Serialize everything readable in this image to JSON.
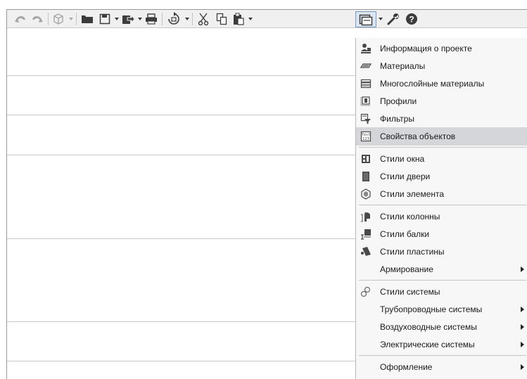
{
  "toolbar": {
    "buttons": [
      {
        "name": "undo-button",
        "icon": "undo-icon",
        "disabled": true
      },
      {
        "name": "redo-button",
        "icon": "redo-icon",
        "disabled": true
      },
      {
        "name": "3d-view-button",
        "icon": "cube-icon",
        "disabled": true
      },
      {
        "name": "open-button",
        "icon": "folder-icon"
      },
      {
        "name": "save-button",
        "icon": "floppy-icon"
      },
      {
        "name": "export-button",
        "icon": "export-icon"
      },
      {
        "name": "print-button",
        "icon": "printer-icon"
      },
      {
        "name": "update-button",
        "icon": "refresh-icon"
      },
      {
        "name": "cut-button",
        "icon": "scissors-icon"
      },
      {
        "name": "copy-button",
        "icon": "copy-icon"
      },
      {
        "name": "paste-button",
        "icon": "paste-icon"
      },
      {
        "name": "manage-styles-button",
        "icon": "styles-icon",
        "active": true
      },
      {
        "name": "settings-button",
        "icon": "wrench-icon"
      },
      {
        "name": "help-button",
        "icon": "help-icon"
      }
    ]
  },
  "menu": {
    "items": [
      {
        "label": "Информация о проекте",
        "icon": "project-info-icon"
      },
      {
        "label": "Материалы",
        "icon": "materials-icon"
      },
      {
        "label": "Многослойные материалы",
        "icon": "multilayer-icon"
      },
      {
        "label": "Профили",
        "icon": "profiles-icon"
      },
      {
        "label": "Фильтры",
        "icon": "filters-icon"
      },
      {
        "label": "Свойства объектов",
        "icon": "object-properties-icon",
        "highlighted": true
      },
      {
        "label": "Стили окна",
        "icon": "window-style-icon"
      },
      {
        "label": "Стили двери",
        "icon": "door-style-icon"
      },
      {
        "label": "Стили элемента",
        "icon": "element-style-icon"
      },
      {
        "label": "Стили колонны",
        "icon": "column-style-icon"
      },
      {
        "label": "Стили балки",
        "icon": "beam-style-icon"
      },
      {
        "label": "Стили пластины",
        "icon": "plate-style-icon"
      },
      {
        "label": "Армирование",
        "submenu": true
      },
      {
        "label": "Стили системы",
        "icon": "system-style-icon"
      },
      {
        "label": "Трубопроводные системы",
        "submenu": true
      },
      {
        "label": "Воздуховодные системы",
        "submenu": true
      },
      {
        "label": "Электрические системы",
        "submenu": true
      },
      {
        "label": "Оформление",
        "submenu": true
      }
    ]
  },
  "colors": {
    "highlight": "#d4d6d9",
    "menu_bg": "#f7f7f7",
    "active_button": "#dce6f2"
  }
}
